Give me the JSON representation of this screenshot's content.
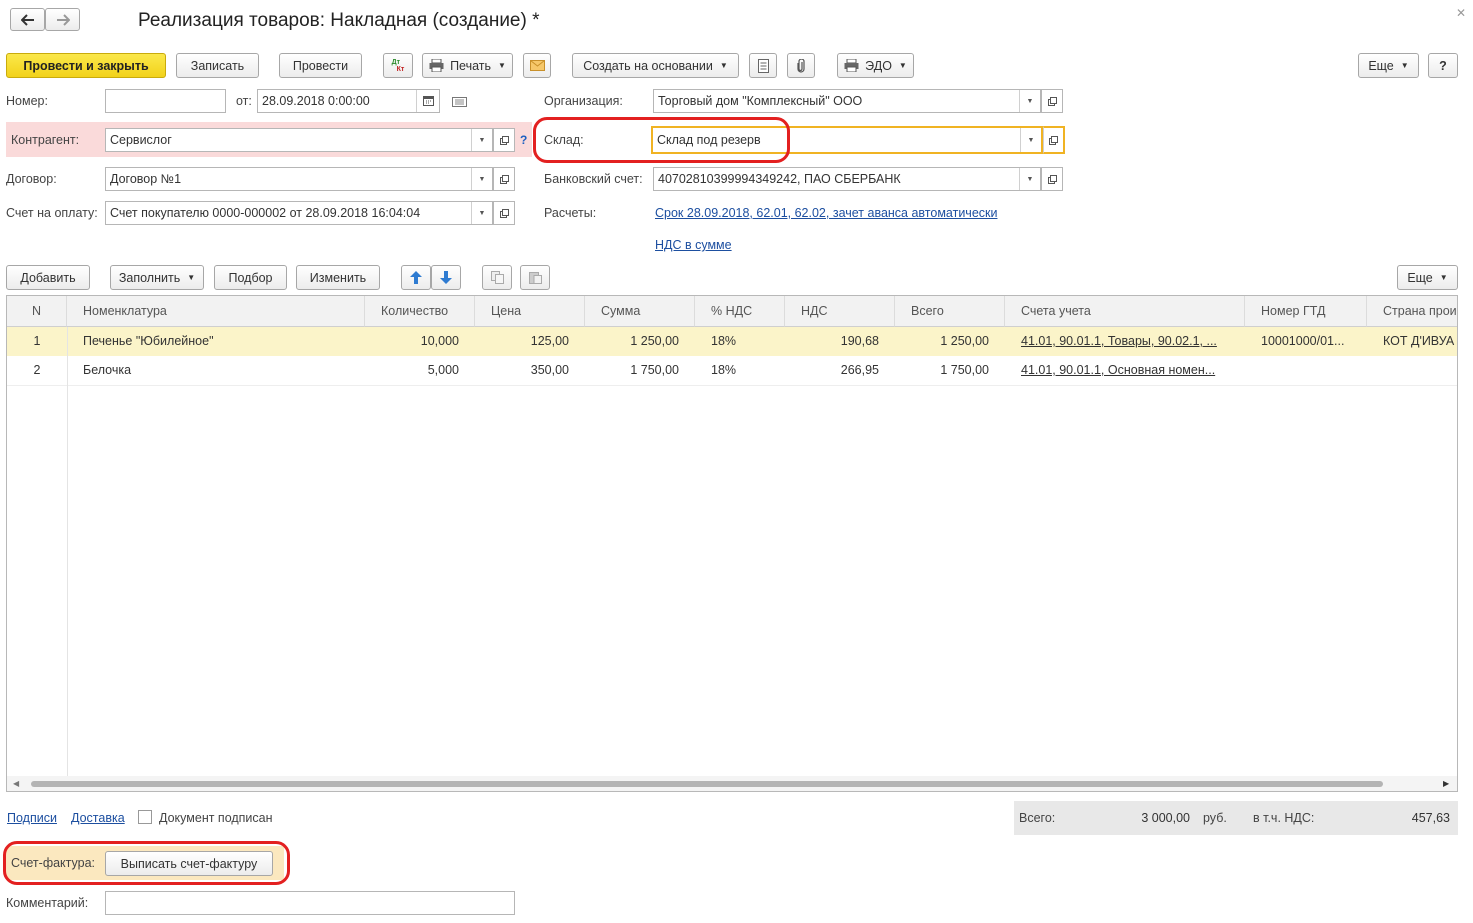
{
  "window": {
    "title": "Реализация товаров: Накладная (создание) *"
  },
  "toolbar": {
    "post_close": "Провести и закрыть",
    "save": "Записать",
    "post": "Провести",
    "print": "Печать",
    "create_based": "Создать на основании",
    "edo": "ЭДО",
    "more": "Еще",
    "help": "?",
    "dtkt_top": "Дт",
    "dtkt_bottom": "Кт"
  },
  "form": {
    "number_label": "Номер:",
    "number_value": "",
    "date_label": "от:",
    "date_value": "28.09.2018  0:00:00",
    "org_label": "Организация:",
    "org_value": "Торговый дом \"Комплексный\" ООО",
    "counterparty_label": "Контрагент:",
    "counterparty_value": "Сервислог",
    "question": "?",
    "warehouse_label": "Склад:",
    "warehouse_value": "Склад под резерв",
    "contract_label": "Договор:",
    "contract_value": "Договор №1",
    "bank_label": "Банковский счет:",
    "bank_value": "40702810399994349242, ПАО СБЕРБАНК",
    "invoice_label": "Счет на оплату:",
    "invoice_value": "Счет покупателю 0000-000002 от 28.09.2018 16:04:04",
    "settlements_label": "Расчеты:",
    "settlements_link": "Срок 28.09.2018, 62.01, 62.02, зачет аванса автоматически",
    "vat_link": "НДС в сумме"
  },
  "table_toolbar": {
    "add": "Добавить",
    "fill": "Заполнить",
    "pick": "Подбор",
    "change": "Изменить",
    "more": "Еще"
  },
  "table": {
    "columns": [
      "N",
      "Номенклатура",
      "Количество",
      "Цена",
      "Сумма",
      "% НДС",
      "НДС",
      "Всего",
      "Счета учета",
      "Номер ГТД",
      "Страна прои"
    ],
    "rows": [
      {
        "n": "1",
        "name": "Печенье \"Юбилейное\"",
        "qty": "10,000",
        "price": "125,00",
        "sum": "1 250,00",
        "vat_rate": "18%",
        "vat": "190,68",
        "total": "1 250,00",
        "accounts": "41.01, 90.01.1, Товары, 90.02.1, ...",
        "gtd": "10001000/01...",
        "country": "КОТ Д'ИВУА"
      },
      {
        "n": "2",
        "name": "Белочка",
        "qty": "5,000",
        "price": "350,00",
        "sum": "1 750,00",
        "vat_rate": "18%",
        "vat": "266,95",
        "total": "1 750,00",
        "accounts": "41.01, 90.01.1, Основная номен...",
        "gtd": "",
        "country": ""
      }
    ]
  },
  "footer": {
    "signatures": "Подписи",
    "delivery": "Доставка",
    "signed": "Документ подписан",
    "total_label": "Всего:",
    "total_value": "3 000,00",
    "currency": "руб.",
    "vat_label": "в т.ч. НДС:",
    "vat_value": "457,63",
    "invoice_label": "Счет-фактура:",
    "invoice_button": "Выписать счет-фактуру",
    "comment_label": "Комментарий:",
    "comment_value": ""
  },
  "colors": {
    "primary_button": "#f2d21b",
    "highlight_row": "#fbf4c9",
    "counterparty_bg": "#fadada",
    "focus_border": "#f0b323",
    "link": "#1d4fa0",
    "annotation": "#e32020"
  }
}
